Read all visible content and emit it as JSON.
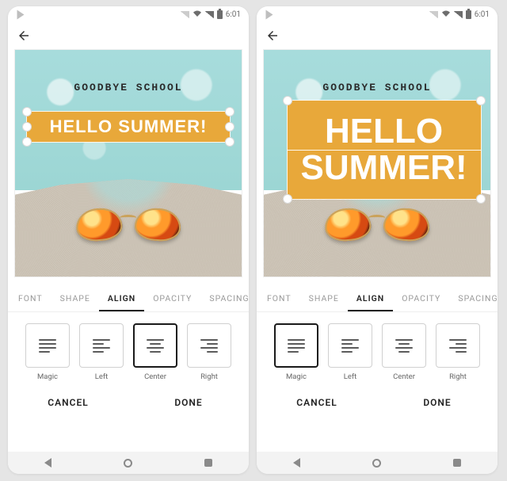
{
  "status": {
    "time": "6:01"
  },
  "canvas": {
    "text_top": "GOODBYE SCHOOL",
    "text_main_single": "HELLO SUMMER!",
    "text_main_multi": "HELLO\nSUMMER!",
    "highlight_color": "#e8a83a"
  },
  "tabs": [
    {
      "label": "FONT"
    },
    {
      "label": "SHAPE"
    },
    {
      "label": "ALIGN",
      "active": true
    },
    {
      "label": "OPACITY"
    },
    {
      "label": "SPACING"
    }
  ],
  "align_options": [
    {
      "id": "magic",
      "label": "Magic"
    },
    {
      "id": "left",
      "label": "Left"
    },
    {
      "id": "center",
      "label": "Center"
    },
    {
      "id": "right",
      "label": "Right"
    }
  ],
  "screens": [
    {
      "active_align": "center",
      "text_variant": "single"
    },
    {
      "active_align": "magic",
      "text_variant": "multi"
    }
  ],
  "footer": {
    "cancel": "CANCEL",
    "done": "DONE"
  }
}
